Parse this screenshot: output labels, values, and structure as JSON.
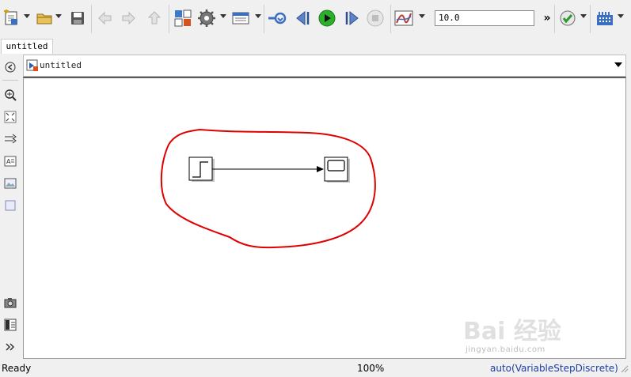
{
  "toolbar": {
    "stop_time_value": "10.0",
    "more_label": "»",
    "icons": [
      "new-model-icon",
      "open-icon",
      "save-icon",
      "back-icon",
      "forward-icon",
      "up-icon",
      "library-browser-icon",
      "model-config-icon",
      "model-explorer-icon",
      "update-diagram-icon",
      "step-back-icon",
      "run-icon",
      "step-forward-icon",
      "stop-icon",
      "signal-viewer-icon",
      "model-advisor-icon",
      "build-icon"
    ]
  },
  "tab": {
    "label": "untitled"
  },
  "address": {
    "path": "untitled"
  },
  "status": {
    "ready": "Ready",
    "zoom": "100%",
    "solver": "auto(VariableStepDiscrete)"
  },
  "colors": {
    "annotation": "#e00000",
    "run_green": "#2bb02b",
    "solver_text": "#1a3fa0"
  },
  "watermark": {
    "text": "Bai 经验",
    "url": "jingyan.baidu.com"
  }
}
